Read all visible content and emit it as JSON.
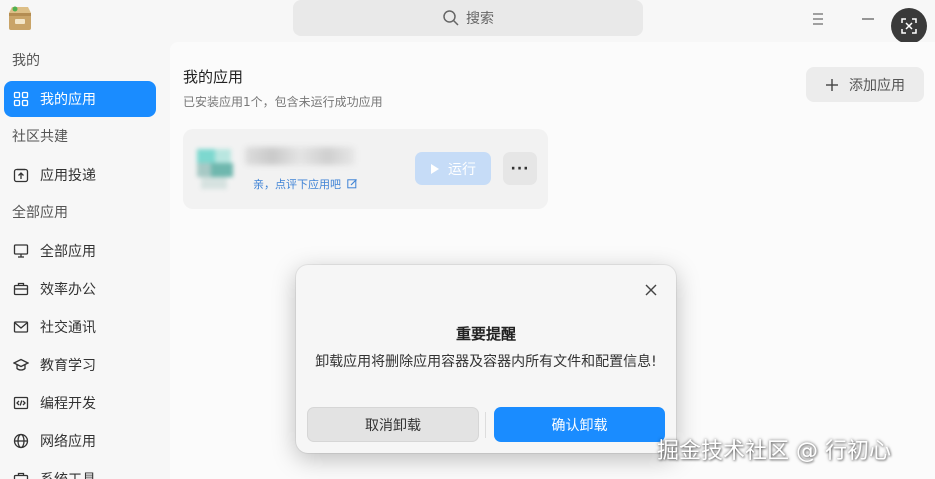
{
  "titlebar": {
    "search_placeholder": "搜索",
    "menu_icon": "hamburger-menu-icon",
    "minimize_icon": "minimize-icon"
  },
  "sidebar": {
    "sections": [
      {
        "label": "我的",
        "items": [
          {
            "label": "我的应用",
            "icon": "grid-icon",
            "active": true
          }
        ]
      },
      {
        "label": "社区共建",
        "items": [
          {
            "label": "应用投递",
            "icon": "upload-icon"
          }
        ]
      },
      {
        "label": "全部应用",
        "items": [
          {
            "label": "全部应用",
            "icon": "monitor-icon"
          },
          {
            "label": "效率办公",
            "icon": "briefcase-icon"
          },
          {
            "label": "社交通讯",
            "icon": "mail-icon"
          },
          {
            "label": "教育学习",
            "icon": "graduation-cap-icon"
          },
          {
            "label": "编程开发",
            "icon": "code-icon"
          },
          {
            "label": "网络应用",
            "icon": "globe-icon"
          },
          {
            "label": "系统工具",
            "icon": "tools-icon"
          }
        ]
      }
    ]
  },
  "main": {
    "title": "我的应用",
    "subtitle": "已安装应用1个，包含未运行成功应用",
    "add_button": "添加应用",
    "app_card": {
      "review_text": "亲，点评下应用吧",
      "run_button": "运行",
      "more_button": "···"
    }
  },
  "dialog": {
    "title": "重要提醒",
    "message": "卸载应用将删除应用容器及容器内所有文件和配置信息!",
    "cancel_button": "取消卸载",
    "confirm_button": "确认卸载"
  },
  "watermark": "掘金技术社区 @ 行初心",
  "colors": {
    "accent": "#1a8cff",
    "run_disabled": "#c6dcf7",
    "background": "#f7f7f7"
  }
}
